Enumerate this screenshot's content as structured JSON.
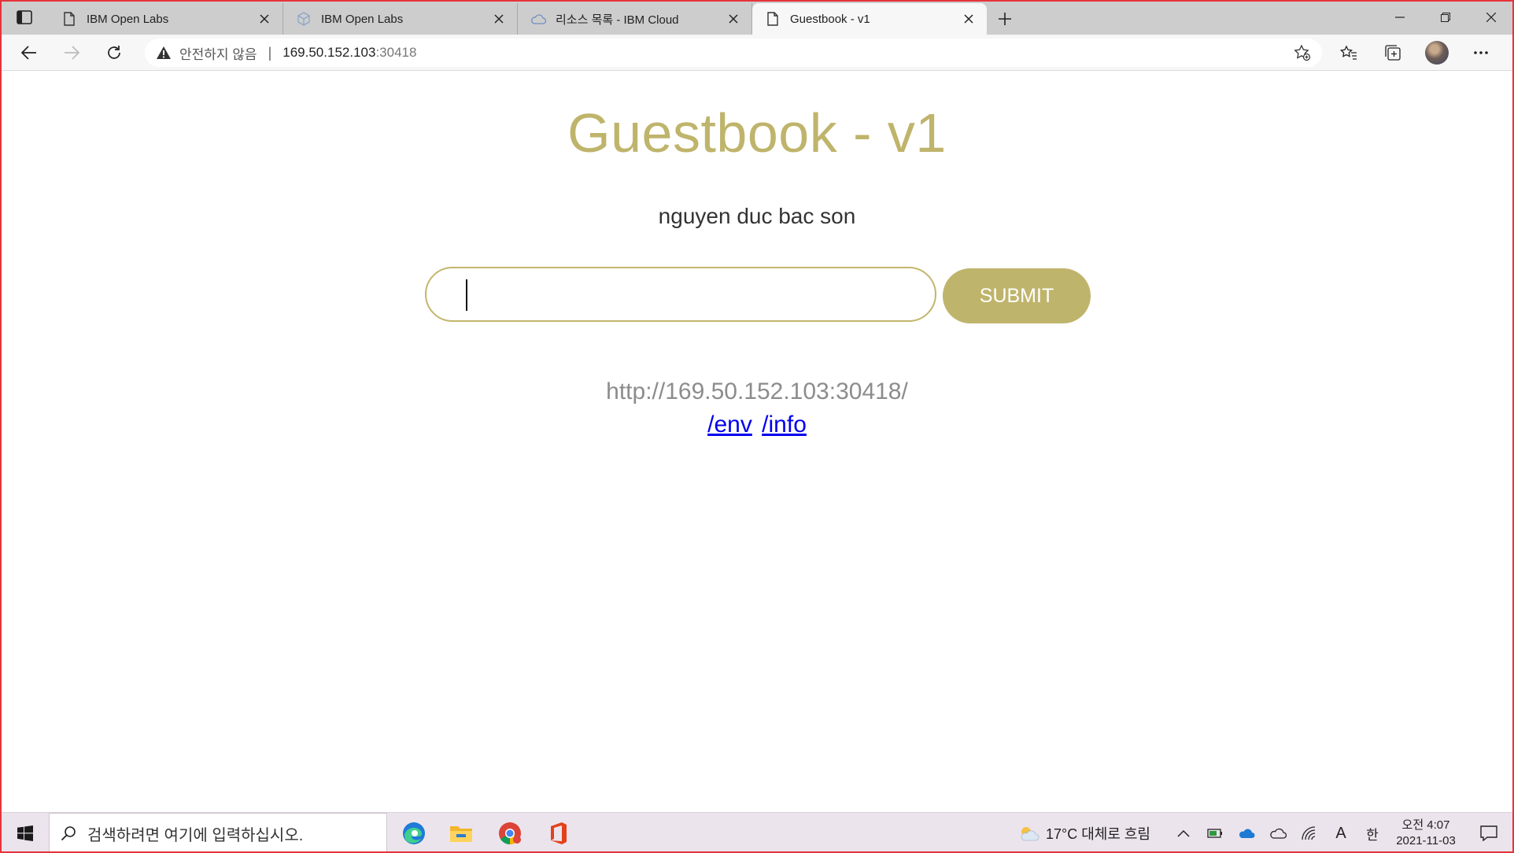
{
  "browser": {
    "tabs": [
      {
        "title": "IBM Open Labs",
        "icon": "page-icon",
        "active": false
      },
      {
        "title": "IBM Open Labs",
        "icon": "cube-icon",
        "active": false
      },
      {
        "title": "리소스 목록 - IBM Cloud",
        "icon": "cloud-icon",
        "active": false
      },
      {
        "title": "Guestbook - v1",
        "icon": "page-icon",
        "active": true
      }
    ],
    "address": {
      "security_label": "안전하지 않음",
      "separator": "|",
      "host": "169.50.152.103",
      "port": ":30418"
    }
  },
  "page": {
    "title": "Guestbook - v1",
    "entries": [
      "nguyen duc bac son"
    ],
    "input_value": "",
    "submit_label": "SUBMIT",
    "host_url": "http://169.50.152.103:30418/",
    "links": [
      {
        "label": "/env"
      },
      {
        "label": "/info"
      }
    ]
  },
  "taskbar": {
    "search_placeholder": "검색하려면 여기에 입력하십시오.",
    "apps": [
      "edge-icon",
      "file-explorer-icon",
      "chrome-icon",
      "office-icon"
    ],
    "weather": "17°C  대체로 흐림",
    "ime_lang": "A",
    "ime_mode": "한",
    "time": "오전 4:07",
    "date": "2021-11-03"
  },
  "colors": {
    "accent": "#bfb46b",
    "link": "#0000ee",
    "frame": "#e5333b"
  }
}
